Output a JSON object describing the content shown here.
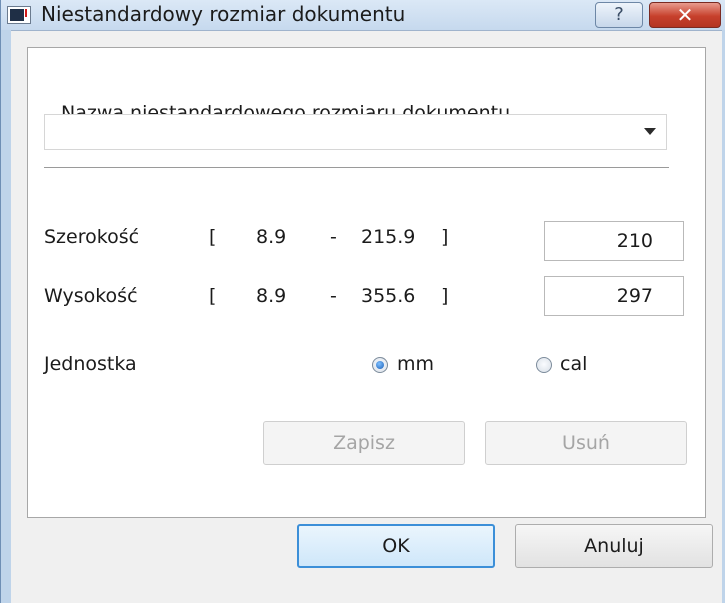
{
  "window": {
    "title": "Niestandardowy rozmiar dokumentu",
    "help_label": "?",
    "close_label": "✕"
  },
  "form": {
    "name_label": "Nazwa niestandardowego rozmiaru dokumentu",
    "name_value": "",
    "width": {
      "label": "Szerokość",
      "open_bracket": "[",
      "min": "8.9",
      "dash": "-",
      "max": "215.9",
      "close_bracket": "]",
      "value": "210"
    },
    "height": {
      "label": "Wysokość",
      "open_bracket": "[",
      "min": "8.9",
      "dash": "-",
      "max": "355.6",
      "close_bracket": "]",
      "value": "297"
    },
    "unit": {
      "label": "Jednostka",
      "options": [
        {
          "label": "mm",
          "selected": true
        },
        {
          "label": "cal",
          "selected": false
        }
      ]
    },
    "save_label": "Zapisz",
    "delete_label": "Usuń"
  },
  "footer": {
    "ok_label": "OK",
    "cancel_label": "Anuluj"
  }
}
